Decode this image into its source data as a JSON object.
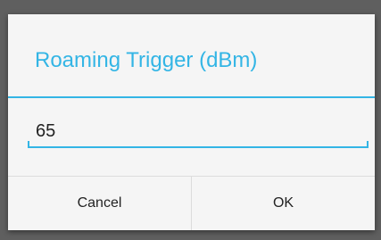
{
  "dialog": {
    "title": "Roaming Trigger (dBm)",
    "input_value": "65",
    "cancel_label": "Cancel",
    "ok_label": "OK"
  },
  "colors": {
    "accent": "#33b5e5",
    "backdrop": "#5f5f5f",
    "dialog_background": "#f5f5f5",
    "text": "#222222",
    "divider": "#dcdcdc"
  }
}
